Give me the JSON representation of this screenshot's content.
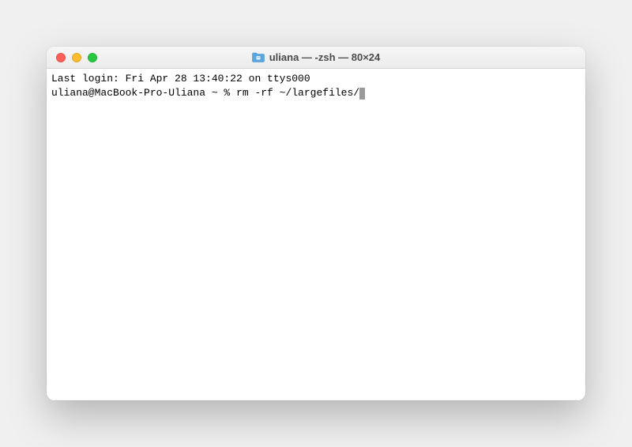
{
  "window": {
    "title": "uliana — -zsh — 80×24"
  },
  "terminal": {
    "line1": "Last login: Fri Apr 28 13:40:22 on ttys000",
    "prompt": "uliana@MacBook-Pro-Uliana ~ % ",
    "command": "rm -rf ~/largefiles/"
  }
}
